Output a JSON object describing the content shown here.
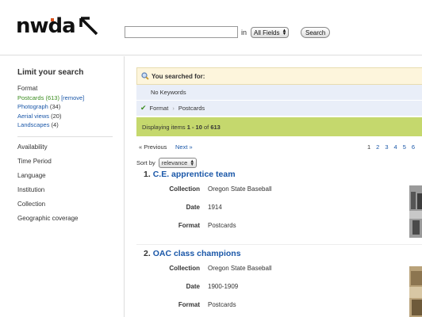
{
  "header": {
    "logo_text": "nwda",
    "search_value": "",
    "in_label": "in",
    "field_select": "All Fields",
    "search_button": "Search"
  },
  "sidebar": {
    "title": "Limit your search",
    "format_heading": "Format",
    "format_items": [
      {
        "label": "Postcards",
        "count": "(613)",
        "remove": "[remove]",
        "selected": true
      },
      {
        "label": "Photograph",
        "count": "(34)"
      },
      {
        "label": "Aerial views",
        "count": "(20)"
      },
      {
        "label": "Landscapes",
        "count": "(4)"
      }
    ],
    "facets": [
      "Availability",
      "Time Period",
      "Language",
      "Institution",
      "Collection",
      "Geographic coverage"
    ]
  },
  "main": {
    "searched_for": "You searched for:",
    "no_keywords": "No Keywords",
    "filter_field": "Format",
    "filter_sep": "›",
    "filter_value": "Postcards",
    "displaying_prefix": "Displaying items",
    "displaying_range": "1 - 10",
    "displaying_of": "of",
    "displaying_total": "613",
    "prev_label": "« Previous",
    "next_label": "Next »",
    "pages": [
      "1",
      "2",
      "3",
      "4",
      "5",
      "6"
    ],
    "sort_label": "Sort by",
    "sort_value": "relevance"
  },
  "results": [
    {
      "num": "1.",
      "title": "C.E. apprentice team",
      "collection_label": "Collection",
      "collection": "Oregon State Baseball",
      "date_label": "Date",
      "date": "1914",
      "format_label": "Format",
      "format": "Postcards"
    },
    {
      "num": "2.",
      "title": "OAC class champions",
      "collection_label": "Collection",
      "collection": "Oregon State Baseball",
      "date_label": "Date",
      "date": "1900-1909",
      "format_label": "Format",
      "format": "Postcards"
    }
  ],
  "colors": {
    "link": "#1a57a8",
    "selected_facet": "#3a8c1e",
    "display_bar": "#c5d86d",
    "searched_bar": "#fdf5dc",
    "criteria_bg": "#e9eef8",
    "logo_accent": "#d9531e"
  },
  "icons": [
    "search-magnifier-icon",
    "checkmark-icon",
    "logo-arrow-icon",
    "select-updown-icon"
  ]
}
